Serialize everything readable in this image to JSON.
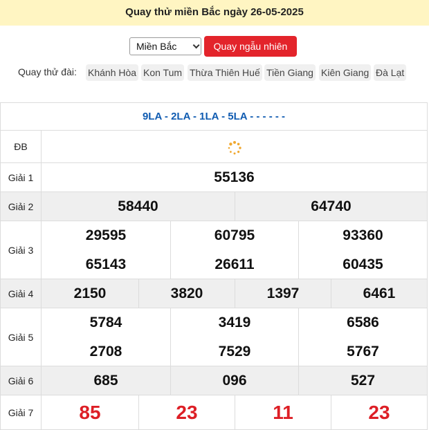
{
  "header": {
    "title": "Quay thử miền Bắc ngày 26-05-2025"
  },
  "controls": {
    "region_select": "Miền Bắc",
    "random_button": "Quay ngẫu nhiên"
  },
  "stations": {
    "label": "Quay thử đài:",
    "items": [
      "Khánh Hòa",
      "Kon Tum",
      "Thừa Thiên Huế",
      "Tiền Giang",
      "Kiên Giang",
      "Đà Lạt"
    ]
  },
  "result": {
    "codes": "9LA - 2LA - 1LA - 5LA - - - - - -",
    "db_label": "ĐB",
    "prizes": [
      {
        "label": "Giải 1",
        "numbers": [
          "55136"
        ]
      },
      {
        "label": "Giải 2",
        "numbers": [
          "58440",
          "64740"
        ]
      },
      {
        "label": "Giải 3",
        "numbers": [
          "29595",
          "60795",
          "93360",
          "65143",
          "26611",
          "60435"
        ]
      },
      {
        "label": "Giải 4",
        "numbers": [
          "2150",
          "3820",
          "1397",
          "6461"
        ]
      },
      {
        "label": "Giải 5",
        "numbers": [
          "5784",
          "3419",
          "6586",
          "2708",
          "7529",
          "5767"
        ]
      },
      {
        "label": "Giải 6",
        "numbers": [
          "685",
          "096",
          "527"
        ]
      },
      {
        "label": "Giải 7",
        "numbers": [
          "85",
          "23",
          "11",
          "23"
        ]
      }
    ]
  },
  "colors": {
    "header_bg": "#fff5c2",
    "accent_red": "#e3242b",
    "code_blue": "#0f5bb1",
    "shade": "#efefef"
  }
}
